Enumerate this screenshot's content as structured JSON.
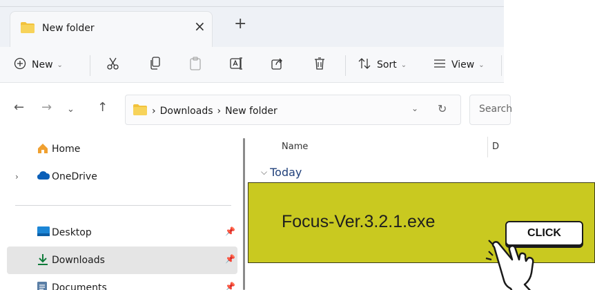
{
  "tab": {
    "title": "New folder",
    "close": "×",
    "new_tab": "+"
  },
  "toolbar": {
    "new_label": "New",
    "sort_label": "Sort",
    "view_label": "View",
    "chevron": "⌄"
  },
  "address": {
    "crumbs": [
      "Downloads",
      "New folder"
    ],
    "separator": "›",
    "search_placeholder": "Search"
  },
  "nav": {
    "items": [
      {
        "label": "Home",
        "icon": "home-icon"
      },
      {
        "label": "OneDrive",
        "icon": "cloud-icon"
      },
      {
        "label": "Desktop",
        "icon": "desktop-icon"
      },
      {
        "label": "Downloads",
        "icon": "download-icon"
      },
      {
        "label": "Documents",
        "icon": "document-icon"
      }
    ]
  },
  "content": {
    "column_name": "Name",
    "column_date": "D",
    "group": "Today",
    "file_name": "Focus-Ver.3.2.1.exe"
  },
  "overlay": {
    "click_label": "CLICK"
  },
  "colors": {
    "banner": "#c9c920",
    "folder": "#f2c23c",
    "accent": "#0067c0",
    "group_text": "#1f3f7a"
  }
}
